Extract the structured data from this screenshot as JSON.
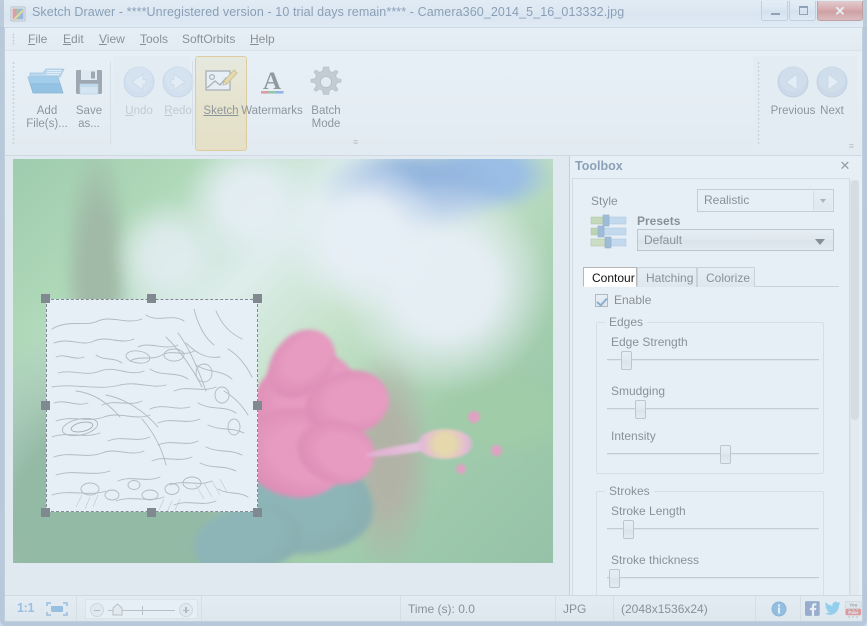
{
  "window": {
    "title": "Sketch Drawer - ****Unregistered version - 10 trial days remain**** - Camera360_2014_5_16_013332.jpg",
    "app_icon": "sketch-drawer-icon",
    "minimize_label": "–",
    "maximize_label": "❐",
    "close_label": "✕"
  },
  "menu": {
    "items": [
      {
        "label": "File",
        "accel": "F",
        "rest": "ile"
      },
      {
        "label": "Edit",
        "accel": "E",
        "rest": "dit"
      },
      {
        "label": "View",
        "accel": "V",
        "rest": "iew"
      },
      {
        "label": "Tools",
        "accel": "T",
        "rest": "ools"
      },
      {
        "label": "SoftOrbits",
        "accel": "",
        "rest": "SoftOrbits"
      },
      {
        "label": "Help",
        "accel": "H",
        "rest": "elp"
      }
    ]
  },
  "toolbar": {
    "add_files": "Add\nFile(s)...",
    "save_as": "Save\nas...",
    "undo": "Undo",
    "redo": "Redo",
    "sketch": "Sketch",
    "watermarks": "Watermarks",
    "batch_mode": "Batch\nMode",
    "previous": "Previous",
    "next": "Next",
    "expand_label": "≡",
    "active_tool": "Sketch"
  },
  "toolbox": {
    "title": "Toolbox",
    "close_label": "✕",
    "style_label": "Style",
    "style_value": "Realistic",
    "presets_label": "Presets",
    "presets_value": "Default",
    "presets_icon": "sliders-icon",
    "tabs": [
      {
        "label": "Contour",
        "selected": true
      },
      {
        "label": "Hatching",
        "selected": false
      },
      {
        "label": "Colorize",
        "selected": false
      }
    ],
    "enable_label": "Enable",
    "enable_checked": true,
    "groups": [
      {
        "title": "Edges",
        "sliders": [
          {
            "label": "Edge Strength",
            "value": 7
          },
          {
            "label": "Smudging",
            "value": 16
          },
          {
            "label": "Intensity",
            "value": 55
          }
        ]
      },
      {
        "title": "Strokes",
        "sliders": [
          {
            "label": "Stroke Length",
            "value": 8
          },
          {
            "label": "Stroke thickness",
            "value": 1
          }
        ]
      }
    ]
  },
  "statusbar": {
    "zoom_ratio": "1:1",
    "fit_icon": "fit-to-screen-icon",
    "zoom_out_icon": "zoom-out-icon",
    "zoom_in_icon": "zoom-in-icon",
    "time": "Time (s): 0.0",
    "format": "JPG",
    "dimensions": "(2048x1536x24)",
    "info_icon": "info-icon",
    "facebook_icon": "facebook-icon",
    "twitter_icon": "twitter-icon",
    "youtube_icon": "youtube-icon"
  },
  "canvas": {
    "image_name": "Camera360_2014_5_16_013332.jpg",
    "selection_note": "sketch-preview-selection"
  },
  "colors": {
    "accent": "#e8a92c",
    "title_text": "#14335c",
    "zoom_blue": "#3a84c8",
    "close_red": "#c13c33"
  }
}
